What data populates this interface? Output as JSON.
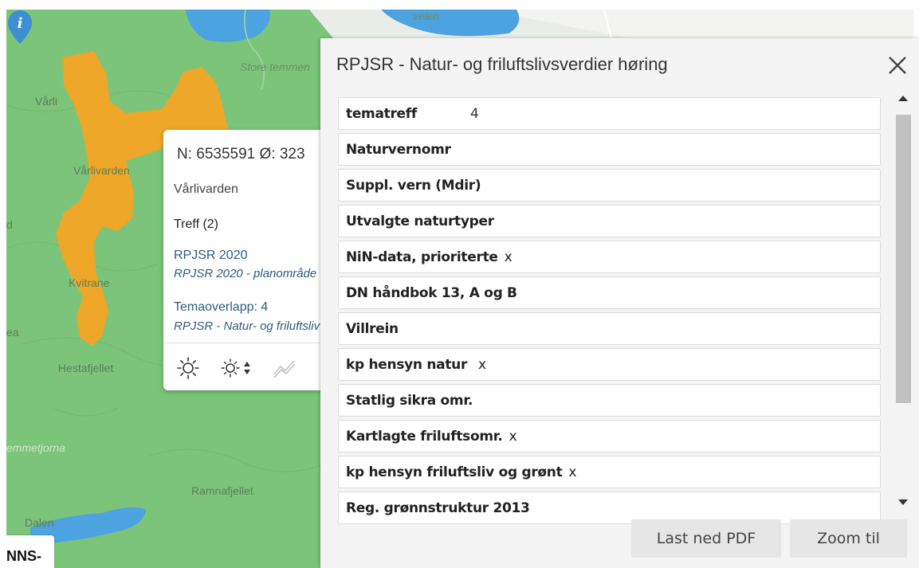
{
  "map": {
    "labels": {
      "varli": "Vårli",
      "storetemmen": "Store temmen",
      "varlivarden": "Vårlivarden",
      "kvitrane": "Kvitrane",
      "hestafjellet": "Hestafjellet",
      "ramnafjellet": "Ramnafjellet",
      "dalen": "Dalen",
      "veien": "veien",
      "temmetjorna": "emmetjorna",
      "d": "d",
      "ea": "ea"
    },
    "corner_badge": "NNS-",
    "pin_icon": "info-marker-icon"
  },
  "info_popup": {
    "coordinates": "N: 6535591 Ø: 323",
    "place": "Vårlivarden",
    "hits_heading": "Treff (2)",
    "hits": [
      {
        "title": "RPJSR 2020",
        "subtitle": "RPJSR 2020 - planområde"
      },
      {
        "title": "Temaoverlapp: 4",
        "subtitle": "RPJSR - Natur- og friluftsliv"
      }
    ],
    "tools": [
      "sun-icon",
      "sun-adjust-icon",
      "elevation-profile-icon"
    ]
  },
  "panel": {
    "title": "RPJSR - Natur- og friluftslivsverdier høring",
    "close_icon": "close-icon",
    "rows": [
      {
        "label": "tematreff",
        "count": "4",
        "mark": ""
      },
      {
        "label": "Naturvernomr",
        "count": "",
        "mark": ""
      },
      {
        "label": "Suppl. vern (Mdir)",
        "count": "",
        "mark": ""
      },
      {
        "label": "Utvalgte naturtyper",
        "count": "",
        "mark": ""
      },
      {
        "label": "NiN-data, prioriterte",
        "count": "",
        "mark": "x"
      },
      {
        "label": "DN håndbok 13, A og B",
        "count": "",
        "mark": ""
      },
      {
        "label": "Villrein",
        "count": "",
        "mark": ""
      },
      {
        "label": "kp hensyn natur",
        "count": "",
        "mark": "x"
      },
      {
        "label": "Statlig sikra omr.",
        "count": "",
        "mark": ""
      },
      {
        "label": "Kartlagte friluftsomr.",
        "count": "",
        "mark": "x"
      },
      {
        "label": "kp hensyn friluftsliv og grønt",
        "count": "",
        "mark": "x"
      },
      {
        "label": "Reg. grønnstruktur 2013",
        "count": "",
        "mark": ""
      }
    ],
    "buttons": {
      "pdf": "Last ned PDF",
      "zoom": "Zoom til"
    }
  },
  "colors": {
    "map_green": "#7cc47a",
    "highlight_orange": "#f3a423",
    "water_blue": "#4da3e0",
    "link_blue": "#2a5d7d",
    "pin_blue": "#3d8fd0"
  }
}
